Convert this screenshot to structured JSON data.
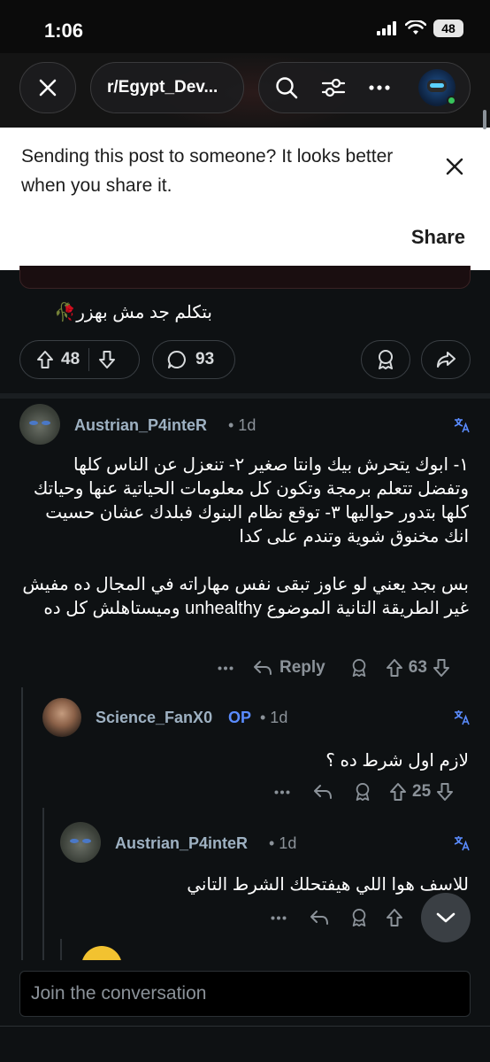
{
  "status_bar": {
    "time": "1:06",
    "battery": "48"
  },
  "nav": {
    "subreddit": "r/Egypt_Dev..."
  },
  "banner": {
    "message": "Sending this post to someone? It looks better when you share it.",
    "share_label": "Share"
  },
  "post": {
    "text_tail": "بتكلم جد مش بهزر🥀",
    "upvotes": "48",
    "comments": "93"
  },
  "comments": [
    {
      "user": "Austrian_P4inteR",
      "age": "• 1d",
      "body": "١- ابوك يتحرش بيك وانتا صغير ٢- تنعزل عن الناس كلها وتفضل تتعلم برمجة وتكون كل معلومات الحياتية عنها وحياتك كلها بتدور حواليها ٣- توقع نظام البنوك فبلدك عشان حسيت انك مخنوق شوية وتندم على كدا\n\nبس بجد يعني لو عاوز تبقى نفس مهاراته في المجال ده مفيش غير الطريقة التانية الموضوع unhealthy وميستاهلش كل ده",
      "reply_label": "Reply",
      "votes": "63"
    },
    {
      "user": "Science_FanX0",
      "op_badge": "OP",
      "age": "• 1d",
      "body": "لازم اول شرط ده ؟",
      "votes": "25"
    },
    {
      "user": "Austrian_P4inteR",
      "age": "• 1d",
      "body": "للاسف هوا اللي هيفتحلك الشرط التاني"
    }
  ],
  "composer": {
    "placeholder": "Join the conversation"
  },
  "colors": {
    "background": "#0e1113",
    "banner": "#ffffff",
    "op_badge": "#5a8cff",
    "username": "#9eb1c2"
  }
}
